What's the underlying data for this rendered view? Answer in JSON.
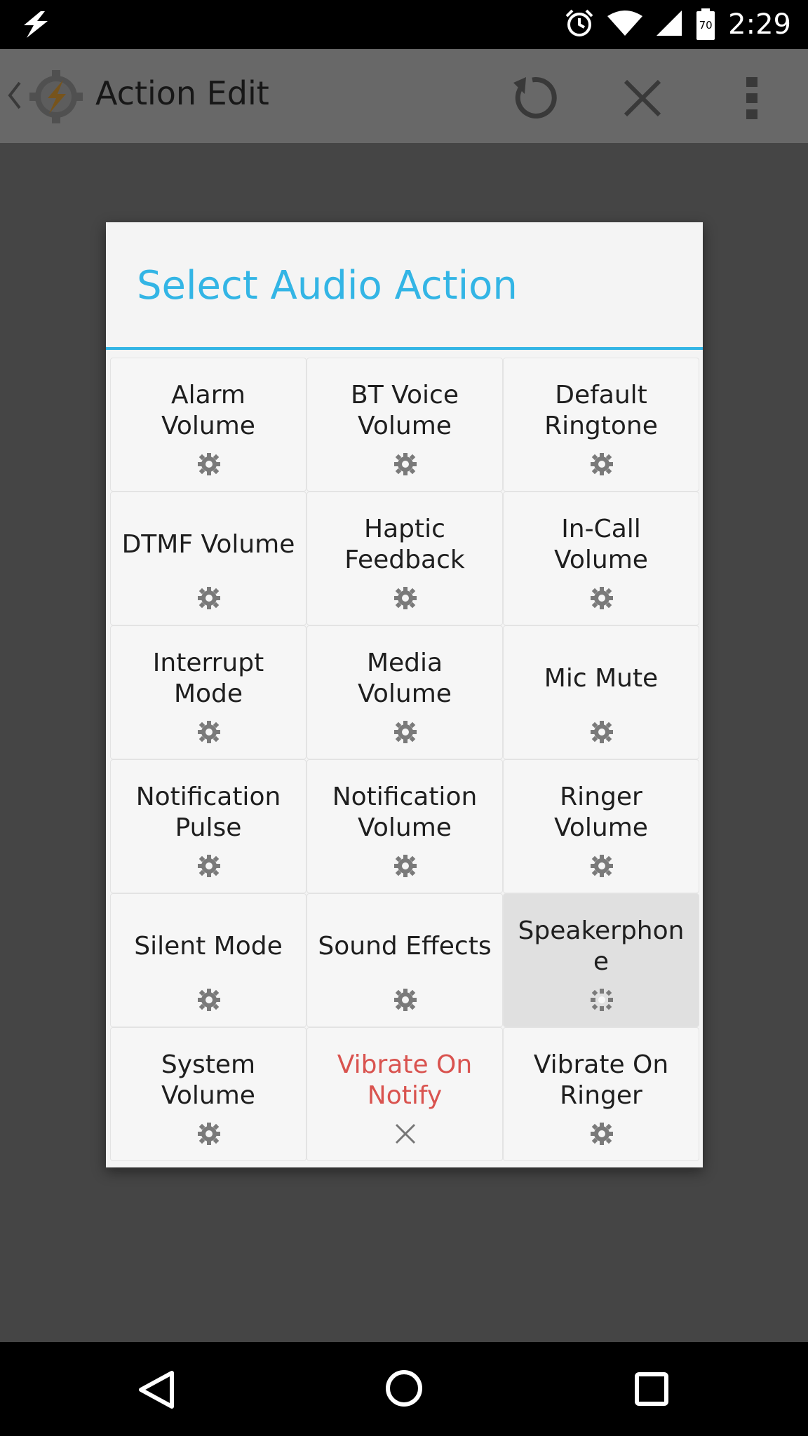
{
  "status_bar": {
    "time": "2:29",
    "battery_level": "70",
    "icons": [
      "flash-icon",
      "alarm-icon",
      "wifi-icon",
      "signal-icon",
      "battery-icon"
    ]
  },
  "app_bar": {
    "title": "Action Edit",
    "icons": [
      "back-chevron-icon",
      "tasker-app-icon",
      "undo-icon",
      "close-icon",
      "more-vert-icon"
    ]
  },
  "dialog": {
    "title": "Select Audio Action",
    "accent_color": "#33b5e5",
    "items": [
      {
        "label": "Alarm\nVolume",
        "icon": "gear-icon"
      },
      {
        "label": "BT Voice\nVolume",
        "icon": "gear-icon"
      },
      {
        "label": "Default\nRingtone",
        "icon": "gear-icon"
      },
      {
        "label": "DTMF Volume",
        "icon": "gear-icon"
      },
      {
        "label": "Haptic\nFeedback",
        "icon": "gear-icon"
      },
      {
        "label": "In-Call\nVolume",
        "icon": "gear-icon"
      },
      {
        "label": "Interrupt\nMode",
        "icon": "gear-icon"
      },
      {
        "label": "Media\nVolume",
        "icon": "gear-icon"
      },
      {
        "label": "Mic Mute",
        "icon": "gear-icon"
      },
      {
        "label": "Notification\nPulse",
        "icon": "gear-icon"
      },
      {
        "label": "Notification\nVolume",
        "icon": "gear-icon"
      },
      {
        "label": "Ringer\nVolume",
        "icon": "gear-icon"
      },
      {
        "label": "Silent Mode",
        "icon": "gear-icon"
      },
      {
        "label": "Sound Effects",
        "icon": "gear-icon"
      },
      {
        "label": "Speakerphon\ne",
        "icon": "gear-icon",
        "selected": true
      },
      {
        "label": "System\nVolume",
        "icon": "gear-icon"
      },
      {
        "label": "Vibrate On\nNotify",
        "icon": "close-icon",
        "warning": true,
        "warning_color": "#d9534f"
      },
      {
        "label": "Vibrate On\nRinger",
        "icon": "gear-icon"
      }
    ]
  },
  "nav_bar": {
    "icons": [
      "nav-back-icon",
      "nav-home-icon",
      "nav-recent-icon"
    ]
  }
}
